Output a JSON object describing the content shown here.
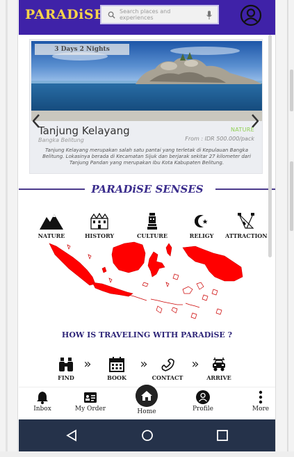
{
  "header": {
    "brand": "PARADiSE",
    "search_placeholder": "Search places and experiences"
  },
  "featured": {
    "badge": "3 Days 2 Nights",
    "name": "Tanjung Kelayang",
    "category": "NATURE",
    "region": "Bangka Belitung",
    "price": "From : IDR 500.000/pack",
    "description": "Tanjung Kelayang merupakan salah satu pantai yang terletak di Kepulauan Bangka Belitung. Lokasinya berada di Kecamatan Sijuk dan berjarak sekitar 27 kilometer dari Tanjung Pandan yang merupakan Ibu Kota Kabupaten Belitung."
  },
  "senses": {
    "title": "PARADiSE SENSES",
    "categories": [
      {
        "label": "NATURE",
        "icon": "mountain-icon"
      },
      {
        "label": "HISTORY",
        "icon": "palace-icon"
      },
      {
        "label": "CULTURE",
        "icon": "statue-icon"
      },
      {
        "label": "RELIGY",
        "icon": "crescent-star-icon"
      },
      {
        "label": "ATTRACTION",
        "icon": "spotlight-icon"
      }
    ]
  },
  "how": {
    "title": "HOW IS TRAVELING WITH PARADiSE ?",
    "steps": [
      {
        "label": "FIND",
        "icon": "binoculars-icon"
      },
      {
        "label": "BOOK",
        "icon": "calendar-icon"
      },
      {
        "label": "CONTACT",
        "icon": "phone-icon"
      },
      {
        "label": "ARRIVE",
        "icon": "car-icon"
      }
    ],
    "separator": "»"
  },
  "bottom_nav": {
    "items": [
      {
        "label": "Inbox",
        "icon": "bell-icon"
      },
      {
        "label": "My Order",
        "icon": "order-card-icon"
      },
      {
        "label": "Home",
        "icon": "home-icon"
      },
      {
        "label": "Profile",
        "icon": "profile-icon"
      },
      {
        "label": "More",
        "icon": "more-vertical-icon"
      }
    ]
  },
  "system_nav": [
    "back-icon",
    "home-circle-icon",
    "recents-icon"
  ],
  "colors": {
    "header_bg": "#3f22a8",
    "brand": "#f7d44a",
    "accent_text": "#3a2c8c",
    "category_green": "#8fcf52",
    "map_red": "#ff0000",
    "system_nav_bg": "#25324a"
  }
}
